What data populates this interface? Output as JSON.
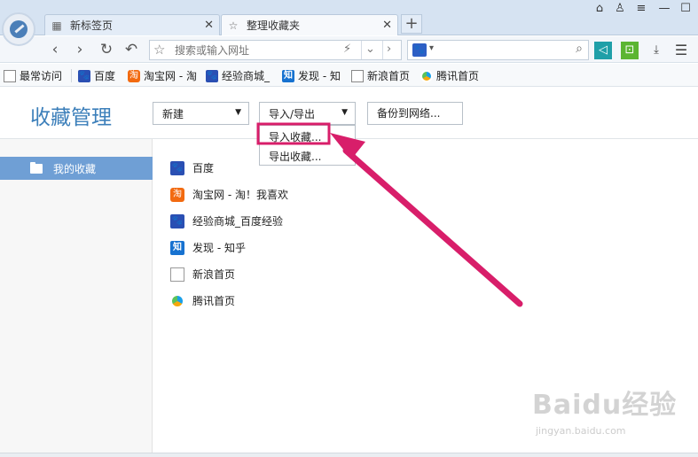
{
  "tabs": [
    {
      "label": "新标签页",
      "icon": "grid-icon"
    },
    {
      "label": "整理收藏夹",
      "icon": "star-icon"
    }
  ],
  "newtab_label": "+",
  "nav": {
    "url_placeholder": "搜索或输入网址"
  },
  "bookmarks_bar": [
    {
      "label": "最常访问",
      "icon": "page-icon"
    },
    {
      "label": "百度",
      "icon": "baidu-paw-icon"
    },
    {
      "label": "淘宝网 - 淘",
      "icon": "taobao-icon"
    },
    {
      "label": "经验商城_",
      "icon": "baidu-paw-icon"
    },
    {
      "label": "发现 - 知",
      "icon": "zhihu-icon"
    },
    {
      "label": "新浪首页",
      "icon": "page-icon"
    },
    {
      "label": "腾讯首页",
      "icon": "qq-icon"
    }
  ],
  "page": {
    "title": "收藏管理",
    "new_label": "新建",
    "import_export_label": "导入/导出",
    "backup_label": "备份到网络...",
    "menu": {
      "import": "导入收藏...",
      "export": "导出收藏..."
    }
  },
  "sidebar": {
    "items": [
      {
        "label": "我的收藏"
      }
    ]
  },
  "favorites": [
    {
      "label": "百度",
      "icon": "baidu-paw-icon",
      "glyph": "🐾"
    },
    {
      "label": "淘宝网 - 淘！我喜欢",
      "icon": "taobao-icon",
      "glyph": "淘"
    },
    {
      "label": "经验商城_百度经验",
      "icon": "baidu-paw-icon",
      "glyph": "🐾"
    },
    {
      "label": "发现 - 知乎",
      "icon": "zhihu-icon",
      "glyph": "知"
    },
    {
      "label": "新浪首页",
      "icon": "page-icon",
      "glyph": ""
    },
    {
      "label": "腾讯首页",
      "icon": "qq-icon",
      "glyph": ""
    }
  ],
  "watermark": {
    "brand": "Baidu经验",
    "url": "jingyan.baidu.com"
  },
  "colors": {
    "accent": "#3c7fba",
    "selected": "#6f9fd5",
    "highlight": "#d81e6a"
  }
}
